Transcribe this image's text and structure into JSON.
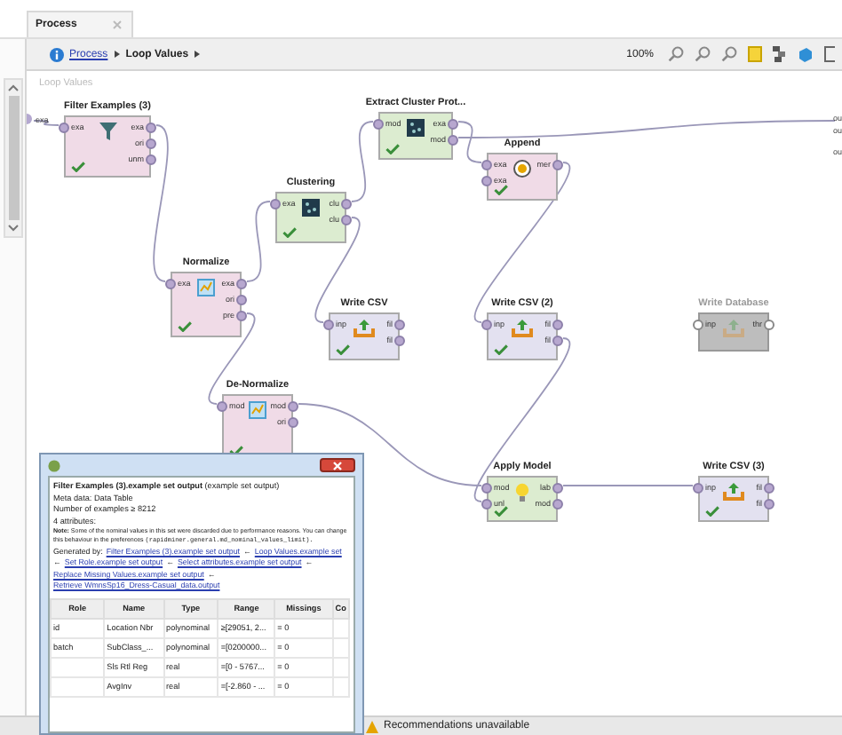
{
  "tab": {
    "title": "Process"
  },
  "breadcrumb": [
    {
      "label": "Process",
      "link": true
    },
    {
      "label": "Loop Values",
      "link": false
    }
  ],
  "zoom": "100%",
  "canvas": {
    "title": "Loop Values",
    "input_port": "exa",
    "output_ports": [
      "ou",
      "ou",
      "ou"
    ]
  },
  "operators": [
    {
      "name": "Filter Examples (3)",
      "kind": "filter",
      "color": "#f0dbe7",
      "enabled": true,
      "ok": true,
      "inputs": [
        "exa"
      ],
      "outputs": [
        "exa",
        "ori",
        "unm"
      ]
    },
    {
      "name": "Extract Cluster Prot...",
      "kind": "clustering",
      "color": "#dcecd0",
      "enabled": true,
      "ok": true,
      "inputs": [
        "mod"
      ],
      "outputs": [
        "exa",
        "mod"
      ]
    },
    {
      "name": "Append",
      "kind": "append",
      "color": "#f0dbe7",
      "enabled": true,
      "ok": true,
      "inputs": [
        "exa",
        "exa"
      ],
      "outputs": [
        "mer"
      ]
    },
    {
      "name": "Clustering",
      "kind": "clustering",
      "color": "#dcecd0",
      "enabled": true,
      "ok": true,
      "inputs": [
        "exa"
      ],
      "outputs": [
        "clu",
        "clu"
      ]
    },
    {
      "name": "Normalize",
      "kind": "normalize",
      "color": "#f0dbe7",
      "enabled": true,
      "ok": true,
      "inputs": [
        "exa"
      ],
      "outputs": [
        "exa",
        "ori",
        "pre"
      ]
    },
    {
      "name": "Write CSV",
      "kind": "write",
      "color": "#e3e1f0",
      "enabled": true,
      "ok": true,
      "inputs": [
        "inp"
      ],
      "outputs": [
        "fil",
        "fil"
      ]
    },
    {
      "name": "Write CSV (2)",
      "kind": "write",
      "color": "#e3e1f0",
      "enabled": true,
      "ok": true,
      "inputs": [
        "inp"
      ],
      "outputs": [
        "fil",
        "fil"
      ]
    },
    {
      "name": "Write Database",
      "kind": "write",
      "color": "#bdbdbd",
      "enabled": false,
      "ok": false,
      "inputs": [
        "inp"
      ],
      "outputs": [
        "thr"
      ]
    },
    {
      "name": "De-Normalize",
      "kind": "normalize",
      "color": "#f0dbe7",
      "enabled": true,
      "ok": true,
      "inputs": [
        "mod"
      ],
      "outputs": [
        "mod",
        "ori"
      ]
    },
    {
      "name": "Apply Model",
      "kind": "apply",
      "color": "#dcecd0",
      "enabled": true,
      "ok": true,
      "inputs": [
        "mod",
        "unl"
      ],
      "outputs": [
        "lab",
        "mod"
      ]
    },
    {
      "name": "Write CSV (3)",
      "kind": "write",
      "color": "#e3e1f0",
      "enabled": true,
      "ok": true,
      "inputs": [
        "inp"
      ],
      "outputs": [
        "fil",
        "fil"
      ]
    }
  ],
  "popup": {
    "heading": "**Filter Examples (3).example set output** (example set output)",
    "lines": [
      "Meta data: Data Table",
      "Number of examples ≥ 8212",
      "4 attributes:"
    ],
    "note": {
      "text": "**Note:** Some of the nominal values in this set were discarded due to performance reasons. You can change this behaviour in the preferences",
      "code": "(rapidminer.general.md_nominal_values_limit)."
    },
    "generated_by": {
      "label": "Generated by:",
      "separator": "←",
      "links": [
        "Filter Examples (3).example set output",
        "Loop Values.example set",
        "Set Role.example set output",
        "Select attributes.example set output",
        "Replace Missing Values.example set output",
        "Retrieve WmnsSp16_Dress-Casual_data.output"
      ]
    },
    "columns": [
      "Role",
      "Name",
      "Type",
      "Range",
      "Missings",
      "Co"
    ],
    "rows": [
      {
        "role": "id",
        "name": "Location Nbr",
        "type": "polynominal",
        "range": "≥[29051, 2...",
        "missings": "= 0"
      },
      {
        "role": "batch",
        "name": "SubClass_...",
        "type": "polynominal",
        "range": "=[0200000...",
        "missings": "= 0"
      },
      {
        "name": "Sls Rtl Reg",
        "type": "real",
        "range": "=[0 - 5767...",
        "missings": "= 0"
      },
      {
        "name": "AvgInv",
        "type": "real",
        "range": "=[-2.860 - ...",
        "missings": "= 0"
      }
    ]
  },
  "status_bar": {
    "text": "Recommendations unavailable"
  }
}
